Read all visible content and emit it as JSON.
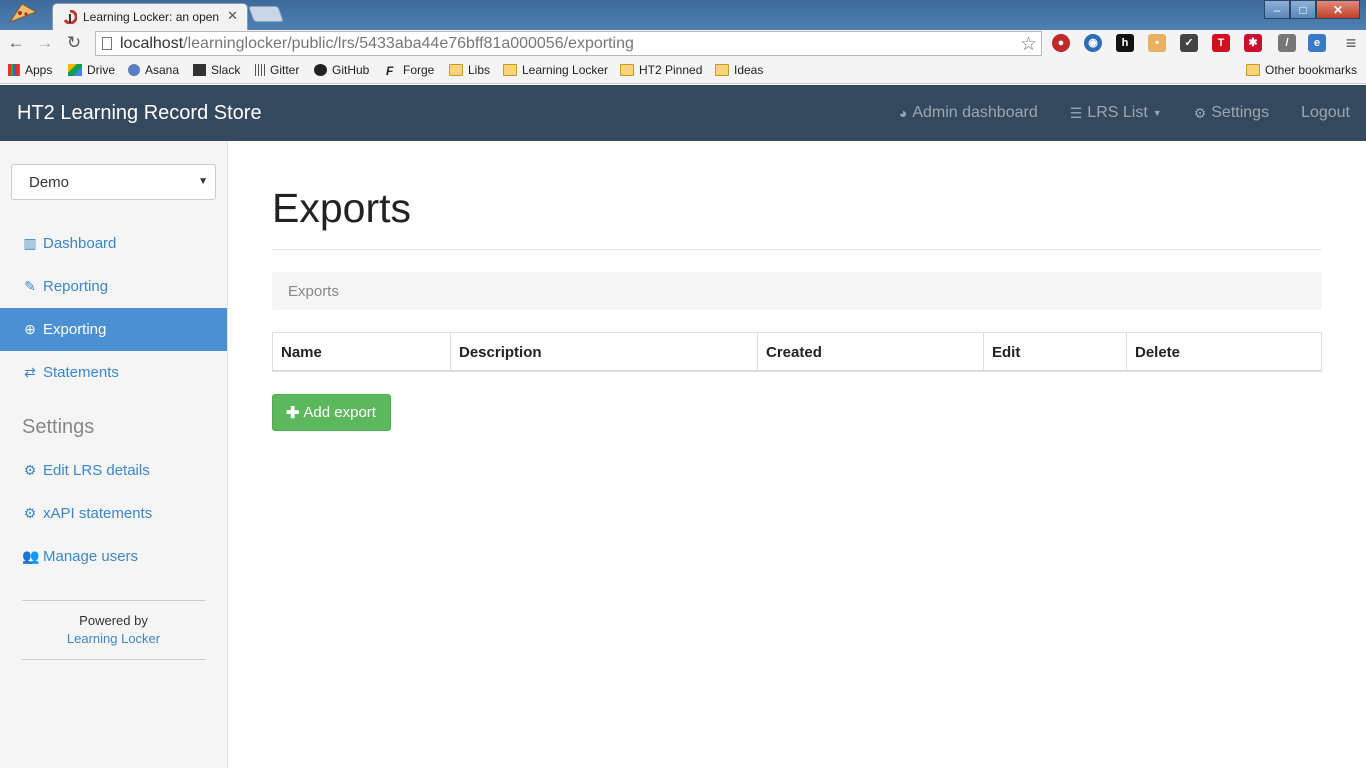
{
  "browser": {
    "tab_title": "Learning Locker: an open",
    "url_host": "localhost",
    "url_path": "/learninglocker/public/lrs/5433aba44e76bff81a000056/exporting",
    "bookmarks": [
      "Apps",
      "Drive",
      "Asana",
      "Slack",
      "Gitter",
      "GitHub",
      "Forge",
      "Libs",
      "Learning Locker",
      "HT2 Pinned",
      "Ideas"
    ],
    "other_bookmarks": "Other bookmarks"
  },
  "app": {
    "brand": "HT2 Learning Record Store",
    "nav": {
      "admin": "Admin dashboard",
      "lrs_list": "LRS List",
      "settings": "Settings",
      "logout": "Logout"
    }
  },
  "sidebar": {
    "selected_lrs": "Demo",
    "items": [
      {
        "label": "Dashboard",
        "icon": "bar-chart-icon"
      },
      {
        "label": "Reporting",
        "icon": "pencil-icon"
      },
      {
        "label": "Exporting",
        "icon": "export-icon",
        "active": true
      },
      {
        "label": "Statements",
        "icon": "exchange-icon"
      }
    ],
    "settings_heading": "Settings",
    "settings_items": [
      {
        "label": "Edit LRS details",
        "icon": "gear-icon"
      },
      {
        "label": "xAPI statements",
        "icon": "gears-icon"
      },
      {
        "label": "Manage users",
        "icon": "users-icon"
      }
    ],
    "powered_by": "Powered by",
    "powered_link": "Learning Locker"
  },
  "main": {
    "title": "Exports",
    "breadcrumb": "Exports",
    "table_headers": [
      "Name",
      "Description",
      "Created",
      "Edit",
      "Delete"
    ],
    "add_button": "Add export"
  },
  "colors": {
    "navbar": "#34495e",
    "active_item": "#4a90d2",
    "link": "#3a87c9",
    "success": "#5cb85c"
  }
}
